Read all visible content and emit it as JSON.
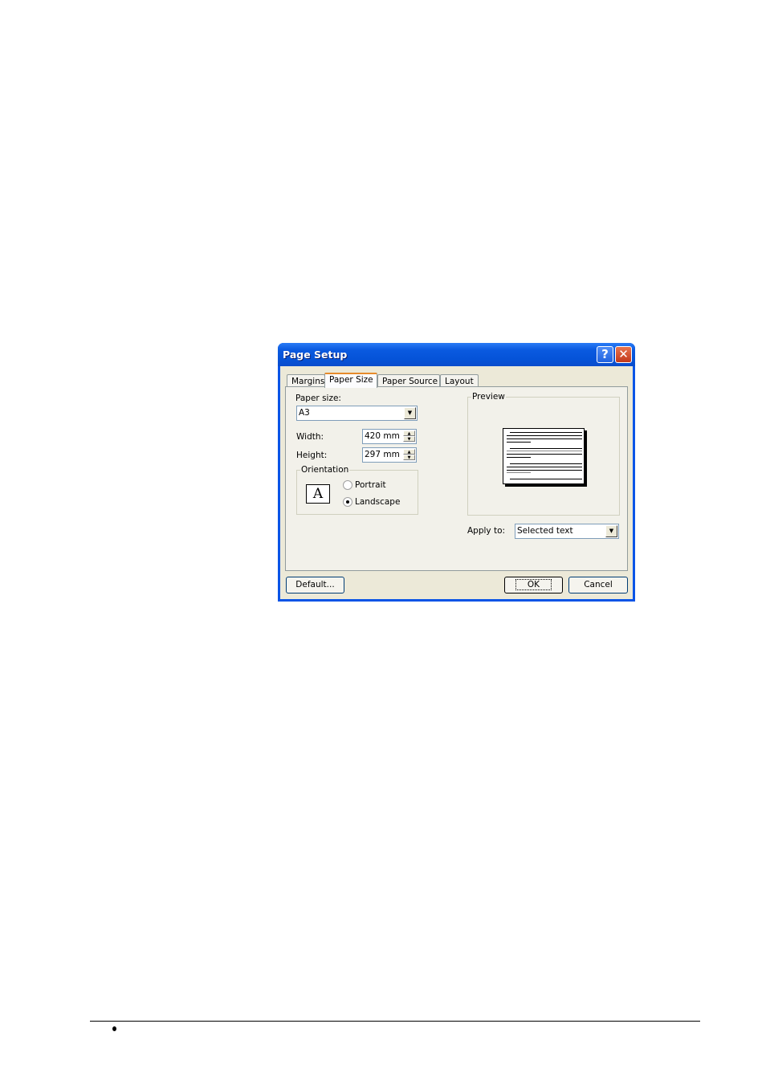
{
  "dialog": {
    "title": "Page Setup",
    "help_button": "?",
    "close_button": "✕",
    "tabs": [
      {
        "label": "Margins",
        "active": false
      },
      {
        "label": "Paper Size",
        "active": true
      },
      {
        "label": "Paper Source",
        "active": false
      },
      {
        "label": "Layout",
        "active": false
      }
    ],
    "paper_size": {
      "label": "Paper size:",
      "value": "A3"
    },
    "width": {
      "label": "Width:",
      "value": "420 mm"
    },
    "height": {
      "label": "Height:",
      "value": "297 mm"
    },
    "orientation": {
      "legend": "Orientation",
      "icon_glyph": "A",
      "options": [
        {
          "label": "Portrait",
          "selected": false
        },
        {
          "label": "Landscape",
          "selected": true
        }
      ]
    },
    "preview": {
      "legend": "Preview"
    },
    "apply_to": {
      "label": "Apply to:",
      "value": "Selected text"
    },
    "buttons": {
      "default": "Default...",
      "ok": "OK",
      "cancel": "Cancel"
    }
  },
  "footer": {
    "bullet": "•"
  }
}
